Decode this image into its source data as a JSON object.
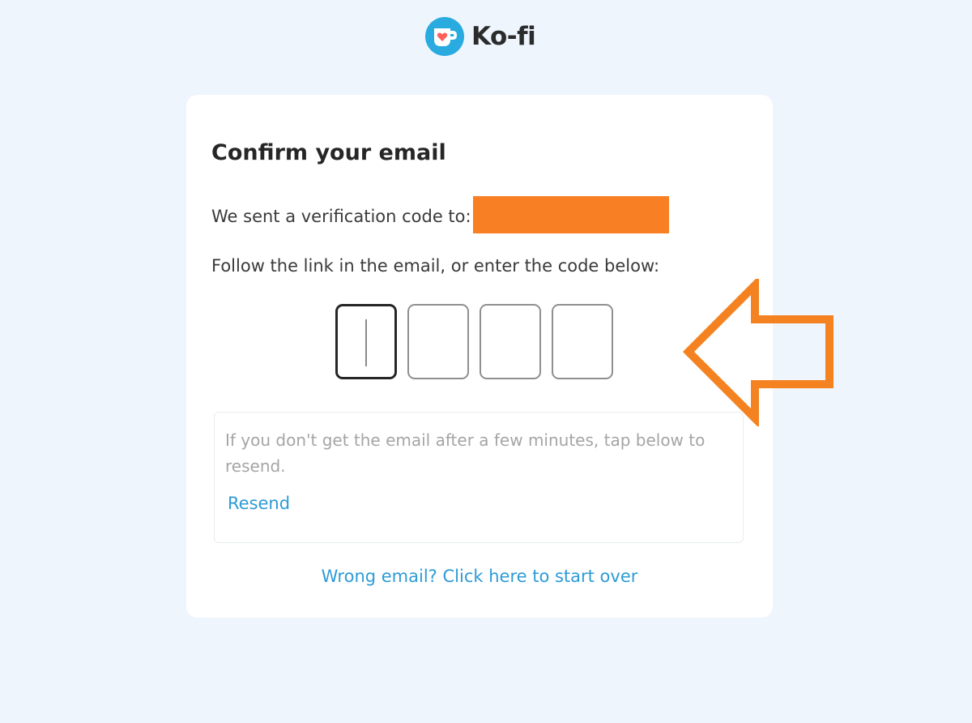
{
  "brand": {
    "name": "Ko-fi",
    "logo_icon": "ko-fi-cup-heart-icon",
    "logo_color": "#29abe0",
    "heart_color": "#ff5e5b"
  },
  "card": {
    "title": "Confirm your email",
    "sent_text": "We sent a verification code to:",
    "redaction_color": "#f97f24",
    "instruction": "Follow the link in the email, or enter the code below:",
    "code_digits": [
      "",
      "",
      "",
      ""
    ],
    "resend_help": "If you don't get the email after a few minutes, tap below to resend.",
    "resend_label": "Resend",
    "start_over_label": "Wrong email? Click here to start over",
    "link_color": "#2d9bd6"
  },
  "annotation": {
    "icon": "orange-arrow-left-icon",
    "color": "#f58220"
  }
}
